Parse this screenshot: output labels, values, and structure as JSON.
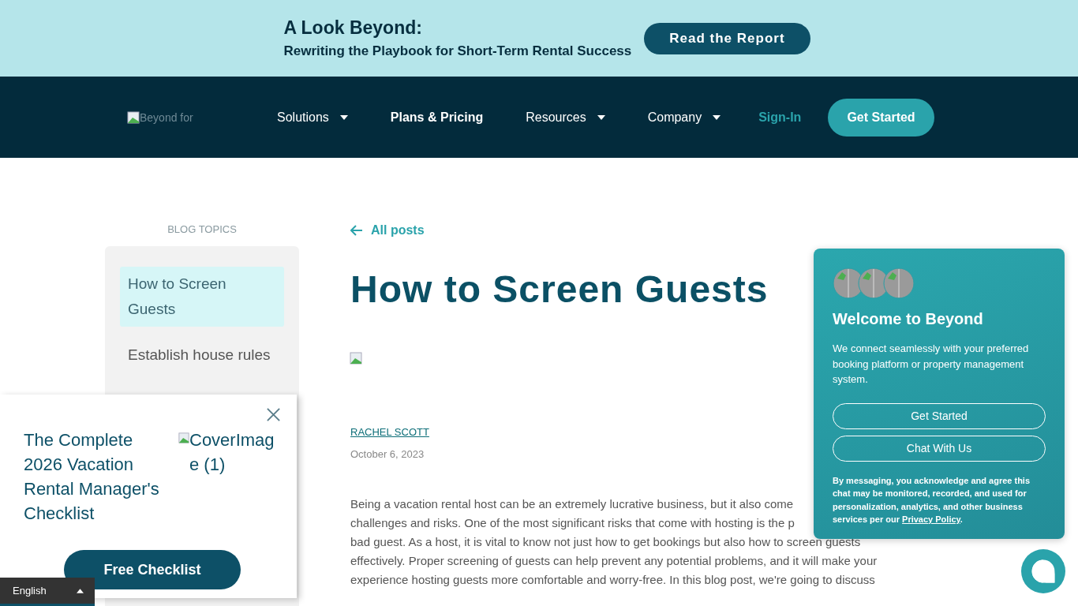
{
  "banner": {
    "title": "A Look Beyond:",
    "subtitle": "Rewriting the Playbook for Short-Term Rental Success",
    "button": "Read the Report"
  },
  "nav": {
    "logo_alt": "Beyond for",
    "items": [
      {
        "label": "Solutions",
        "dropdown": true
      },
      {
        "label": "Plans & Pricing",
        "dropdown": false
      },
      {
        "label": "Resources",
        "dropdown": true
      },
      {
        "label": "Company",
        "dropdown": true
      }
    ],
    "sign_in": "Sign-In",
    "cta": "Get Started"
  },
  "sidebar": {
    "heading": "BLOG TOPICS",
    "items": [
      {
        "label": "How to Screen Guests",
        "selected": true
      },
      {
        "label": "Establish house rules",
        "selected": false
      }
    ]
  },
  "post": {
    "back_link": "All posts",
    "title": "How to Screen Guests",
    "author": "RACHEL SCOTT",
    "date": "October 6, 2023",
    "paragraph_lines": [
      "Being a vacation rental host can be an extremely lucrative business, but it also come",
      "challenges and risks. One of the most significant risks that come with hosting is the p",
      "bad guest. As a host, it is vital to know not just how to get bookings but also how to screen guests",
      "effectively. Proper screening of guests can help prevent any potential problems, and it will make your",
      "experience hosting guests more comfortable and worry-free. In this blog post, we're going to discuss"
    ]
  },
  "checklist_popup": {
    "title": "The Complete 2026 Vacation Rental Manager's Checklist",
    "image_alt": "CoverImage (1)",
    "button": "Free Checklist"
  },
  "language": {
    "label": "English"
  },
  "chat": {
    "title": "Welcome to Beyond",
    "text": "We connect seamlessly with your preferred booking platform or property management system.",
    "buttons": [
      "Get Started",
      "Chat With Us"
    ],
    "disclaimer": "By messaging, you acknowledge and agree this chat may be monitored, recorded, and used for personalization, analytics, and other business services per our",
    "disclaimer_link": "Privacy Policy",
    "disclaimer_end": "."
  }
}
